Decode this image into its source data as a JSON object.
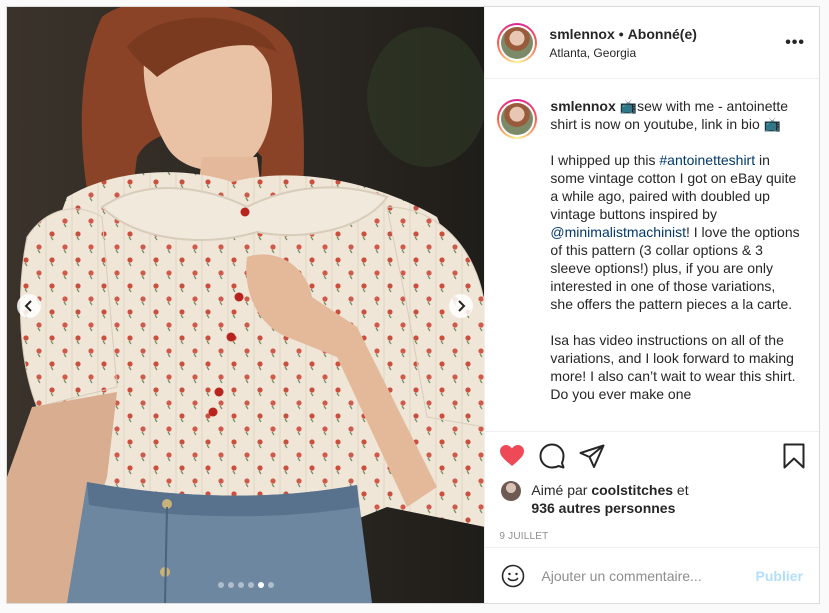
{
  "post": {
    "username": "smlennox",
    "separator": "•",
    "follow_status": "Abonné(e)",
    "location": "Atlanta, Georgia",
    "more_label": "•••"
  },
  "carousel": {
    "slide_count": 6,
    "active_index": 4
  },
  "caption": {
    "username": "smlennox",
    "line1": " 📺sew with me - antoinette shirt is now on youtube, link in bio 📺",
    "p2_part1": "I whipped up this ",
    "p2_tag1": "#antoinetteshirt",
    "p2_part2": " in some vintage cotton I got on eBay quite a while ago, paired with doubled up vintage buttons inspired by ",
    "p2_tag2": "@minimalistmachinist",
    "p2_part3": "! I love the options of this pattern (3 collar options & 3 sleeve options!) plus, if you are only interested in one of those variations, she offers the pattern pieces a la carte.",
    "p3": "Isa has video instructions on all of the variations, and I look forward to making more! I also can’t wait to wear this shirt. Do you ever make one"
  },
  "likes": {
    "prefix": "Aimé par ",
    "user": "coolstitches",
    "middle": " et",
    "count": "936 autres personnes"
  },
  "date": "9 JUILLET",
  "comment_box": {
    "placeholder": "Ajouter un commentaire...",
    "publish_label": "Publier"
  },
  "colors": {
    "heart": "#ed4956",
    "link": "#00376b",
    "publish_disabled": "#b2dffc",
    "muted": "#8e8e8e"
  }
}
